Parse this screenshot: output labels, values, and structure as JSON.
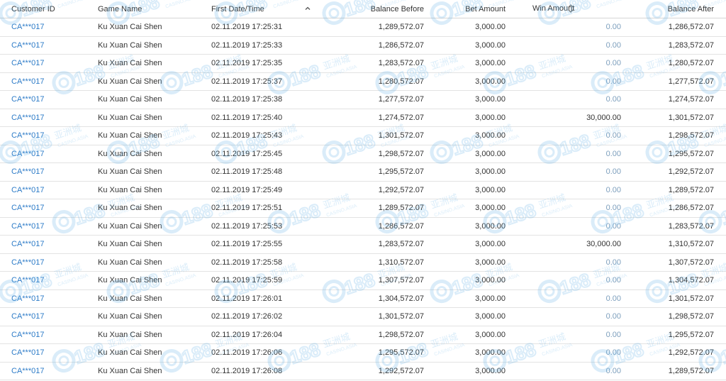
{
  "table": {
    "headers": {
      "customer_id": "Customer ID",
      "game_name": "Game Name",
      "first_date_time": "First Date/Time",
      "balance_before": "Balance Before",
      "bet_amount": "Bet Amount",
      "win_amount": "Win Amount",
      "balance_after": "Balance After"
    },
    "sort": {
      "column": "first_date_time",
      "direction": "ascending"
    },
    "rows": [
      {
        "customer_id": "CA***017",
        "game_name": "Ku Xuan Cai Shen",
        "first_date_time": "02.11.2019 17:25:31",
        "balance_before": "1,289,572.07",
        "bet_amount": "3,000.00",
        "win_amount": "0.00",
        "balance_after": "1,286,572.07"
      },
      {
        "customer_id": "CA***017",
        "game_name": "Ku Xuan Cai Shen",
        "first_date_time": "02.11.2019 17:25:33",
        "balance_before": "1,286,572.07",
        "bet_amount": "3,000.00",
        "win_amount": "0.00",
        "balance_after": "1,283,572.07"
      },
      {
        "customer_id": "CA***017",
        "game_name": "Ku Xuan Cai Shen",
        "first_date_time": "02.11.2019 17:25:35",
        "balance_before": "1,283,572.07",
        "bet_amount": "3,000.00",
        "win_amount": "0.00",
        "balance_after": "1,280,572.07"
      },
      {
        "customer_id": "CA***017",
        "game_name": "Ku Xuan Cai Shen",
        "first_date_time": "02.11.2019 17:25:37",
        "balance_before": "1,280,572.07",
        "bet_amount": "3,000.00",
        "win_amount": "0.00",
        "balance_after": "1,277,572.07"
      },
      {
        "customer_id": "CA***017",
        "game_name": "Ku Xuan Cai Shen",
        "first_date_time": "02.11.2019 17:25:38",
        "balance_before": "1,277,572.07",
        "bet_amount": "3,000.00",
        "win_amount": "0.00",
        "balance_after": "1,274,572.07"
      },
      {
        "customer_id": "CA***017",
        "game_name": "Ku Xuan Cai Shen",
        "first_date_time": "02.11.2019 17:25:40",
        "balance_before": "1,274,572.07",
        "bet_amount": "3,000.00",
        "win_amount": "30,000.00",
        "balance_after": "1,301,572.07"
      },
      {
        "customer_id": "CA***017",
        "game_name": "Ku Xuan Cai Shen",
        "first_date_time": "02.11.2019 17:25:43",
        "balance_before": "1,301,572.07",
        "bet_amount": "3,000.00",
        "win_amount": "0.00",
        "balance_after": "1,298,572.07"
      },
      {
        "customer_id": "CA***017",
        "game_name": "Ku Xuan Cai Shen",
        "first_date_time": "02.11.2019 17:25:45",
        "balance_before": "1,298,572.07",
        "bet_amount": "3,000.00",
        "win_amount": "0.00",
        "balance_after": "1,295,572.07"
      },
      {
        "customer_id": "CA***017",
        "game_name": "Ku Xuan Cai Shen",
        "first_date_time": "02.11.2019 17:25:48",
        "balance_before": "1,295,572.07",
        "bet_amount": "3,000.00",
        "win_amount": "0.00",
        "balance_after": "1,292,572.07"
      },
      {
        "customer_id": "CA***017",
        "game_name": "Ku Xuan Cai Shen",
        "first_date_time": "02.11.2019 17:25:49",
        "balance_before": "1,292,572.07",
        "bet_amount": "3,000.00",
        "win_amount": "0.00",
        "balance_after": "1,289,572.07"
      },
      {
        "customer_id": "CA***017",
        "game_name": "Ku Xuan Cai Shen",
        "first_date_time": "02.11.2019 17:25:51",
        "balance_before": "1,289,572.07",
        "bet_amount": "3,000.00",
        "win_amount": "0.00",
        "balance_after": "1,286,572.07"
      },
      {
        "customer_id": "CA***017",
        "game_name": "Ku Xuan Cai Shen",
        "first_date_time": "02.11.2019 17:25:53",
        "balance_before": "1,286,572.07",
        "bet_amount": "3,000.00",
        "win_amount": "0.00",
        "balance_after": "1,283,572.07"
      },
      {
        "customer_id": "CA***017",
        "game_name": "Ku Xuan Cai Shen",
        "first_date_time": "02.11.2019 17:25:55",
        "balance_before": "1,283,572.07",
        "bet_amount": "3,000.00",
        "win_amount": "30,000.00",
        "balance_after": "1,310,572.07"
      },
      {
        "customer_id": "CA***017",
        "game_name": "Ku Xuan Cai Shen",
        "first_date_time": "02.11.2019 17:25:58",
        "balance_before": "1,310,572.07",
        "bet_amount": "3,000.00",
        "win_amount": "0.00",
        "balance_after": "1,307,572.07"
      },
      {
        "customer_id": "CA***017",
        "game_name": "Ku Xuan Cai Shen",
        "first_date_time": "02.11.2019 17:25:59",
        "balance_before": "1,307,572.07",
        "bet_amount": "3,000.00",
        "win_amount": "0.00",
        "balance_after": "1,304,572.07"
      },
      {
        "customer_id": "CA***017",
        "game_name": "Ku Xuan Cai Shen",
        "first_date_time": "02.11.2019 17:26:01",
        "balance_before": "1,304,572.07",
        "bet_amount": "3,000.00",
        "win_amount": "0.00",
        "balance_after": "1,301,572.07"
      },
      {
        "customer_id": "CA***017",
        "game_name": "Ku Xuan Cai Shen",
        "first_date_time": "02.11.2019 17:26:02",
        "balance_before": "1,301,572.07",
        "bet_amount": "3,000.00",
        "win_amount": "0.00",
        "balance_after": "1,298,572.07"
      },
      {
        "customer_id": "CA***017",
        "game_name": "Ku Xuan Cai Shen",
        "first_date_time": "02.11.2019 17:26:04",
        "balance_before": "1,298,572.07",
        "bet_amount": "3,000.00",
        "win_amount": "0.00",
        "balance_after": "1,295,572.07"
      },
      {
        "customer_id": "CA***017",
        "game_name": "Ku Xuan Cai Shen",
        "first_date_time": "02.11.2019 17:26:06",
        "balance_before": "1,295,572.07",
        "bet_amount": "3,000.00",
        "win_amount": "0.00",
        "balance_after": "1,292,572.07"
      },
      {
        "customer_id": "CA***017",
        "game_name": "Ku Xuan Cai Shen",
        "first_date_time": "02.11.2019 17:26:08",
        "balance_before": "1,292,572.07",
        "bet_amount": "3,000.00",
        "win_amount": "0.00",
        "balance_after": "1,289,572.07"
      }
    ]
  },
  "watermark": {
    "brand": "CC188",
    "cn": "亚洲城",
    "sub": "CASINO.ASIA"
  },
  "colors": {
    "link": "#2e7cc8",
    "zero_win": "#7d9fbd",
    "watermark": "#5aaee6"
  },
  "icons": {
    "sort_ascending": "caret-up-icon",
    "sort_both": "sort-both-icon"
  }
}
